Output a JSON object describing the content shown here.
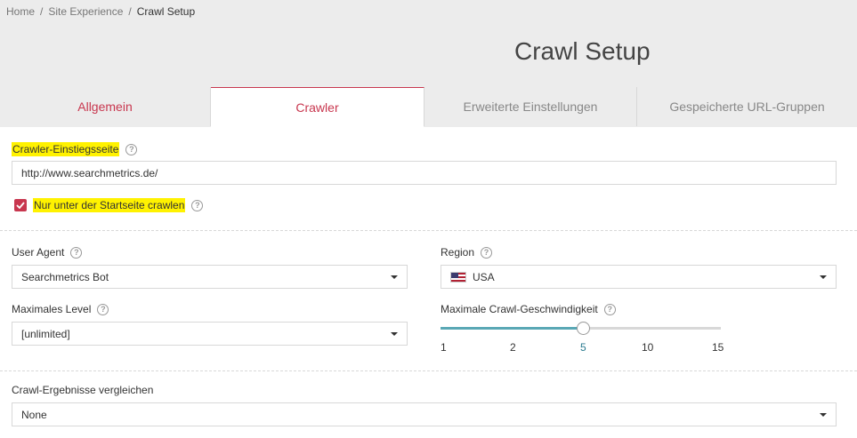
{
  "breadcrumb": {
    "home": "Home",
    "sep": "/",
    "section": "Site Experience",
    "current": "Crawl Setup"
  },
  "page_title": "Crawl Setup",
  "tabs": [
    {
      "label": "Allgemein",
      "active": false
    },
    {
      "label": "Crawler",
      "active": true
    },
    {
      "label": "Erweiterte Einstellungen",
      "active": false
    },
    {
      "label": "Gespeicherte URL-Gruppen",
      "active": false
    }
  ],
  "entry_page": {
    "label": "Crawler-Einstiegsseite",
    "value": "http://www.searchmetrics.de/",
    "help": "?"
  },
  "only_under_start": {
    "label": "Nur unter der Startseite crawlen",
    "checked": true,
    "help": "?"
  },
  "user_agent": {
    "label": "User Agent",
    "value": "Searchmetrics Bot",
    "help": "?"
  },
  "region": {
    "label": "Region",
    "value": "USA",
    "help": "?",
    "flag_icon": "us-flag-icon"
  },
  "max_level": {
    "label": "Maximales Level",
    "value": "[unlimited]",
    "help": "?"
  },
  "max_speed": {
    "label": "Maximale Crawl-Geschwindigkeit",
    "help": "?",
    "ticks": [
      "1",
      "2",
      "5",
      "10",
      "15"
    ],
    "selected": "5"
  },
  "compare": {
    "label": "Crawl-Ergebnisse vergleichen",
    "value": "None"
  },
  "colors": {
    "accent": "#c8374f",
    "highlight": "#fff200",
    "slider": "#5aa8b5"
  }
}
